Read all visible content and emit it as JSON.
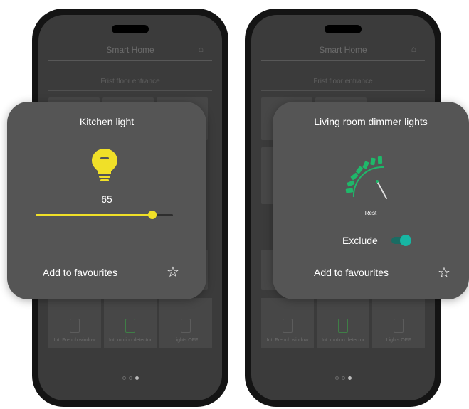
{
  "app_title": "Smart Home",
  "floor_label": "Frist floor entrance",
  "bottom_tiles": [
    {
      "label": "Int. French window"
    },
    {
      "label": "Int. motion detector"
    },
    {
      "label": "Lights OFF"
    }
  ],
  "kitchen_card": {
    "title": "Kitchen light",
    "value": "65",
    "level_percent": 65,
    "favourites_label": "Add to favourites"
  },
  "dimmer_card": {
    "title": "Living room dimmer lights",
    "status": "Rest",
    "exclude_label": "Exclude",
    "favourites_label": "Add to favourites"
  },
  "colors": {
    "accent_yellow": "#f0e028",
    "accent_green": "#1fb86a",
    "toggle_teal": "#17b6a3"
  },
  "icons": [
    "home-icon",
    "bulb-icon",
    "gauge-icon",
    "star-icon"
  ]
}
